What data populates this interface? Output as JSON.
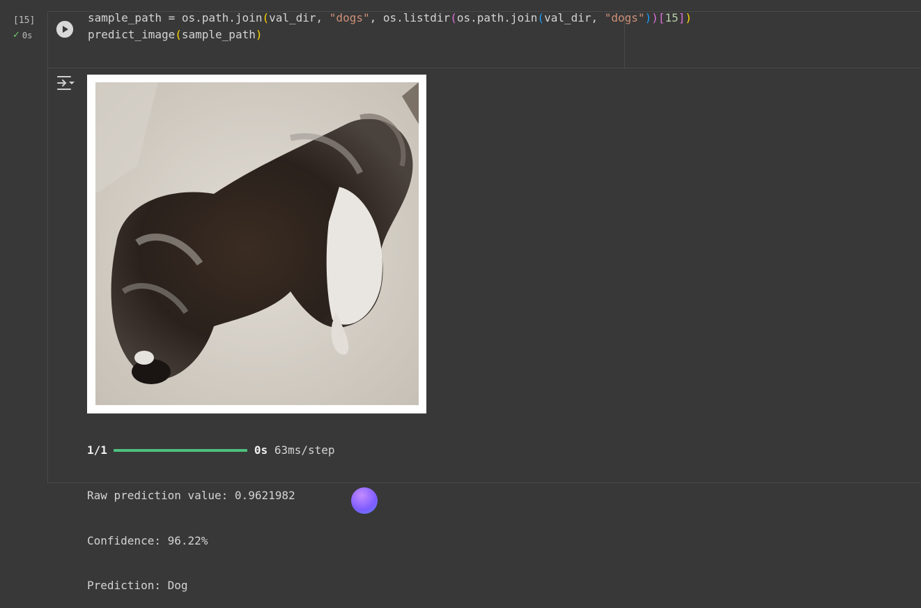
{
  "cell": {
    "execution_count": "[15]",
    "status_time": "0s",
    "code_line1": {
      "a": "sample_path = os.path.join",
      "b": "(",
      "c": "val_dir, ",
      "d": "\"dogs\"",
      "e": ", os.listdir",
      "f": "(",
      "g": "os.path.join",
      "h": "(",
      "i": "val_dir, ",
      "j": "\"dogs\"",
      "k": ")",
      "l": ")",
      "m": "[",
      "n": "15",
      "o": "]",
      "p": ")"
    },
    "code_line2": {
      "a": "predict_image",
      "b": "(",
      "c": "sample_path",
      "d": ")"
    }
  },
  "output": {
    "image_alt": "dog photo",
    "progress_count": "1/1",
    "progress_fraction": 1.0,
    "progress_time": "0s",
    "progress_step": "63ms/step",
    "raw_prediction": "Raw prediction value: 0.9621982",
    "confidence": "Confidence: 96.22%",
    "prediction": "Prediction: Dog"
  },
  "colors": {
    "background": "#383838",
    "progress_bar": "#4fc07f",
    "string": "#ce9178",
    "paren_gold": "#ffd700",
    "paren_purple": "#da70d6",
    "paren_blue": "#179fff"
  },
  "icons": [
    "play-icon",
    "check-icon",
    "output-toggle-icon"
  ]
}
